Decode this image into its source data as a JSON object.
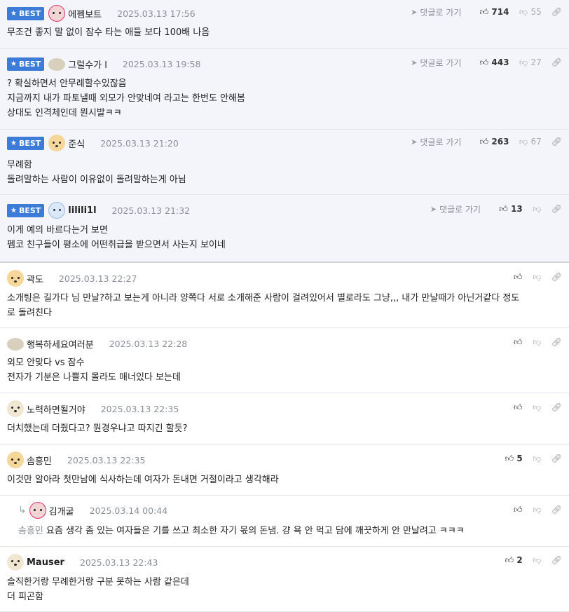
{
  "labels": {
    "best": "BEST",
    "goto": "댓글로 가기"
  },
  "comments": [
    {
      "nick": "에펨보트",
      "date": "2025.03.13 17:56",
      "up": "714",
      "down": "55",
      "lines": [
        "무조건 좋지 말 없이 잠수 타는 애들 보다 100배 나음"
      ]
    },
    {
      "nick": "그럴수가 l",
      "date": "2025.03.13 19:58",
      "up": "443",
      "down": "27",
      "lines": [
        "? 확실하면서 안무례할수있잖음",
        "지금까지 내가 파토낼때 외모가 안맞네여 라고는 한번도 안해봄",
        "상대도 인격체인데 뭔시발ㅋㅋ"
      ]
    },
    {
      "nick": "준식",
      "date": "2025.03.13 21:20",
      "up": "263",
      "down": "67",
      "lines": [
        "무례함",
        "돌려말하는 사람이 이유없이 돌려말하는게 아님"
      ]
    },
    {
      "nick": "lilili1l",
      "date": "2025.03.13 21:32",
      "up": "13",
      "lines": [
        "이게 예의 바르다는거 보면",
        "펨코 친구들이 평소에 어떤취급을 받으면서 사는지 보이네"
      ]
    },
    {
      "nick": "곽도",
      "date": "2025.03.13 22:27",
      "lines": [
        "소개팅은 길가다 님 만날?하고 보는게 아니라 양쪽다 서로 소개해준 사람이 걸려있어서 별로라도 그냥,,, 내가 만날때가 아닌거같다 정도",
        "로 돌려친다"
      ]
    },
    {
      "nick": "행복하세요여러분",
      "date": "2025.03.13 22:28",
      "lines": [
        "외모 안맞다 vs 잠수",
        "전자가 기분은 나쁠지 몰라도 매너있다 보는데"
      ]
    },
    {
      "nick": "노력하면될거야",
      "date": "2025.03.13 22:35",
      "lines": [
        "더치했는데 더줬다고? 뭔경우냐고 따지긴 할듯?"
      ]
    },
    {
      "nick": "솜흥민",
      "date": "2025.03.13 22:35",
      "up": "5",
      "lines": [
        "이것만 알아라 첫만남에 식사하는데 여자가 돈내면 거절이라고 생각해라"
      ]
    },
    {
      "nick": "김개굴",
      "date": "2025.03.14 00:44",
      "mention": "솜흥민",
      "lines": [
        "요즘 생각 좀 있는 여자들은 기를 쓰고 최소한 자기 몫의 돈냄. 걍 욕 안 먹고 담에 깨끗하게 안 만날려고 ㅋㅋㅋ"
      ]
    },
    {
      "nick": "Mauser",
      "date": "2025.03.13 22:43",
      "up": "2",
      "lines": [
        "솔직한거랑 무례한거랑 구분 못하는 사람 같은데",
        "더 피곤함"
      ]
    }
  ],
  "icons": {
    "up": "thumbs-up-icon",
    "down": "thumbs-down-icon",
    "link": "link-icon",
    "goto": "send-arrow-icon"
  },
  "colors": {
    "best_badge": "#3d7bd9",
    "best_bg": "#f3f5fb"
  }
}
